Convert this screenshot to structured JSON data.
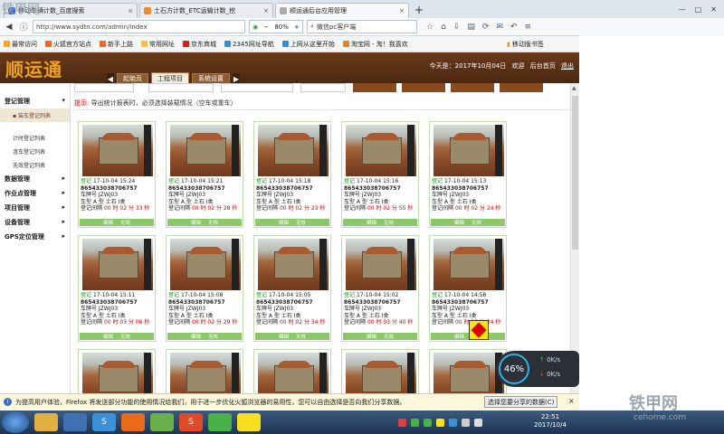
{
  "browser": {
    "tabs": [
      {
        "title": "移动车辆计数_百度搜索",
        "icon_color": "#3b6fd0"
      },
      {
        "title": "土石方计数_ETC运输计数_挖",
        "icon_color": "#f08a2a"
      },
      {
        "title": "顺运通后台应用管理",
        "icon_color": "#aaaaaa"
      }
    ],
    "new_tab_symbol": "+",
    "url": "http://www.sydtn.com/admin/index",
    "zoom": "80%",
    "search_value": "微信pc客户端",
    "bookmarks": [
      {
        "label": "最常访问",
        "color": "#f5a623"
      },
      {
        "label": "火狐官方站点",
        "color": "#e8692a"
      },
      {
        "label": "新手上路",
        "color": "#e8692a"
      },
      {
        "label": "常用网址",
        "color": "#f5c242"
      },
      {
        "label": "京东商城",
        "color": "#d02020"
      },
      {
        "label": "2345网址导航",
        "color": "#3b8fd0"
      },
      {
        "label": "上网从这里开始",
        "color": "#3b8fd0"
      },
      {
        "label": "淘宝网 - 淘！我喜欢",
        "color": "#f08020"
      }
    ],
    "bookmark_right": "移动版书签"
  },
  "app": {
    "logo": "顺运通",
    "tabs": [
      "起始页",
      "工程项目",
      "系统设置"
    ],
    "active_tab": 1,
    "today": "今天是：2017年10月04日",
    "header_links": [
      "欢迎",
      "后台首页",
      "退出"
    ]
  },
  "sidebar": {
    "groups": [
      {
        "label": "登记管理",
        "items": [
          {
            "label": "装车登记列表",
            "active": true
          },
          {
            "label": "计时登记列表"
          },
          {
            "label": "渣车登记列表"
          },
          {
            "label": "无效登记列表"
          }
        ]
      },
      {
        "label": "数据管理",
        "items": []
      },
      {
        "label": "作业点管理",
        "items": []
      },
      {
        "label": "项目管理",
        "items": []
      },
      {
        "label": "设备管理",
        "items": []
      },
      {
        "label": "GPS定位管理",
        "items": []
      }
    ]
  },
  "content": {
    "tip_label": "提示:",
    "tip_text": "导出统计报表时，必须选择装载情况（空车或重车）"
  },
  "cards": [
    {
      "status": "登记",
      "time": "17-10-04 15:24",
      "device": "865433038706757",
      "plate": "车牌号 JZWJ03",
      "type": "车型 A 型 土石 Ⅰ类",
      "interval": "00 时 02 分 33 秒",
      "actions": [
        "编辑",
        "无效"
      ]
    },
    {
      "status": "登记",
      "time": "17-10-04 15:21",
      "device": "865433038706757",
      "plate": "车牌号 JZWJ03",
      "type": "车型 A 型 土石 Ⅰ类",
      "interval": "00 时 02 分 28 秒",
      "actions": [
        "编辑",
        "无效"
      ]
    },
    {
      "status": "登记",
      "time": "17-10-04 15:18",
      "device": "865433038706757",
      "plate": "车牌号 JZWJ03",
      "type": "车型 A 型 土石 Ⅰ类",
      "interval": "00 时 02 分 23 秒",
      "actions": [
        "编辑",
        "无效"
      ]
    },
    {
      "status": "登记",
      "time": "17-10-04 15:16",
      "device": "865433038706757",
      "plate": "车牌号 JZWJ03",
      "type": "车型 A 型 土石 Ⅰ类",
      "interval": "00 时 02 分 55 秒",
      "actions": [
        "编辑",
        "无效"
      ]
    },
    {
      "status": "登记",
      "time": "17-10-04 15:13",
      "device": "865433038706757",
      "plate": "车牌号 JZWJ03",
      "type": "车型 A 型 土石 Ⅰ类",
      "interval": "00 时 02 分 24 秒",
      "actions": [
        "编辑",
        "无效"
      ]
    },
    {
      "status": "登记",
      "time": "17-10-04 15:11",
      "device": "865433038706757",
      "plate": "车牌号 JZWJ03",
      "type": "车型 A 型 土石 Ⅰ类",
      "interval": "00 时 03 分 06 秒",
      "actions": [
        "编辑",
        "无效"
      ]
    },
    {
      "status": "登记",
      "time": "17-10-04 15:08",
      "device": "865433038706757",
      "plate": "车牌号 JZWJ03",
      "type": "车型 A 型 土石 Ⅰ类",
      "interval": "00 时 02 分 29 秒",
      "actions": [
        "编辑",
        "无效"
      ]
    },
    {
      "status": "登记",
      "time": "17-10-04 15:05",
      "device": "865433038706757",
      "plate": "车牌号 JZWJ03",
      "type": "车型 A 型 土石 Ⅰ类",
      "interval": "00 时 02 分 34 秒",
      "actions": [
        "编辑",
        "无效"
      ]
    },
    {
      "status": "登记",
      "time": "17-10-04 15:02",
      "device": "865433038706757",
      "plate": "车牌号 JZWJ03",
      "type": "车型 A 型 土石 Ⅰ类",
      "interval": "00 时 03 分 40 秒",
      "actions": [
        "编辑",
        "无效"
      ]
    },
    {
      "status": "登记",
      "time": "17-10-04 14:58",
      "device": "865433038706757",
      "plate": "车牌号 JZWJ03",
      "type": "车型 A 型 土石 Ⅰ类",
      "interval": "00 时 02 分 24 秒",
      "actions": [
        "编辑",
        "无效"
      ]
    },
    {
      "status": "",
      "time": "",
      "device": "",
      "plate": "",
      "type": "",
      "interval": "",
      "actions": []
    },
    {
      "status": "",
      "time": "",
      "device": "",
      "plate": "",
      "type": "",
      "interval": "",
      "actions": []
    },
    {
      "status": "",
      "time": "",
      "device": "",
      "plate": "",
      "type": "",
      "interval": "",
      "actions": []
    },
    {
      "status": "",
      "time": "",
      "device": "",
      "plate": "",
      "type": "",
      "interval": "",
      "actions": []
    },
    {
      "status": "",
      "time": "",
      "device": "",
      "plate": "",
      "type": "",
      "interval": "",
      "actions": []
    }
  ],
  "interval_prefix": "登记间隔",
  "speed_widget": {
    "percent": "46%",
    "up": "0K/s",
    "down": "0K/s"
  },
  "notice": {
    "text": "为提高用户体验，Firefox 将发送部分功能的使用情况给我们，用于进一步优化火狐浏览器的易用性，您可以自由选择是否向我们分享数据。",
    "button": "选择您要分享的数据(C)",
    "close": "×"
  },
  "taskbar": {
    "time": "22:51",
    "date": "2017/10/4"
  },
  "watermarks": {
    "top_left": "铁甲网",
    "bottom_right": "铁甲网",
    "url": "cehome.com"
  },
  "colors": {
    "header_brown": "#5a3018",
    "logo_orange": "#f0a020",
    "card_border": "#c8d8b0",
    "status_green": "#0a9a0a",
    "interval_red": "#cc0000"
  }
}
